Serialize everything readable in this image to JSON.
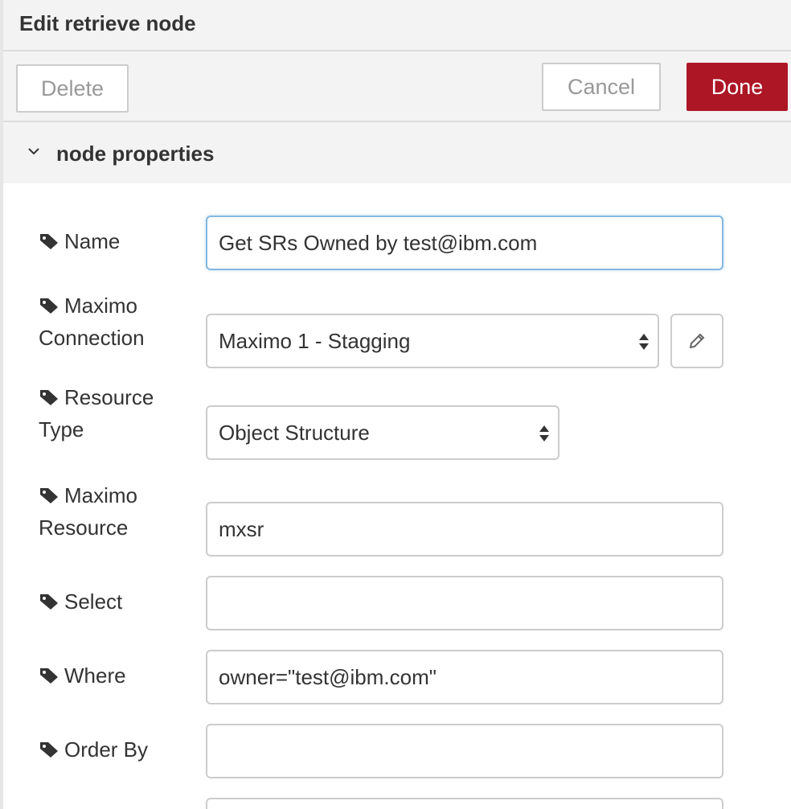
{
  "header": {
    "title": "Edit retrieve node"
  },
  "toolbar": {
    "delete_label": "Delete",
    "cancel_label": "Cancel",
    "done_label": "Done"
  },
  "section": {
    "title": "node properties",
    "icon": "chevron-down-icon"
  },
  "form": {
    "name": {
      "label": "Name",
      "value": "Get SRs Owned by test@ibm.com"
    },
    "connection": {
      "label_line1": "Maximo",
      "label_line2": "Connection",
      "value": "Maximo 1 - Stagging"
    },
    "resource_type": {
      "label_line1": "Resource",
      "label_line2": "Type",
      "value": "Object Structure"
    },
    "resource": {
      "label_line1": "Maximo",
      "label_line2": "Resource",
      "value": "mxsr"
    },
    "select": {
      "label": "Select",
      "value": ""
    },
    "where": {
      "label": "Where",
      "value": "owner=\"test@ibm.com\""
    },
    "order_by": {
      "label": "Order By",
      "value": ""
    }
  },
  "colors": {
    "done": "#ad1625",
    "header_bg": "#f3f3f3",
    "focus_border": "#85b7e0"
  }
}
